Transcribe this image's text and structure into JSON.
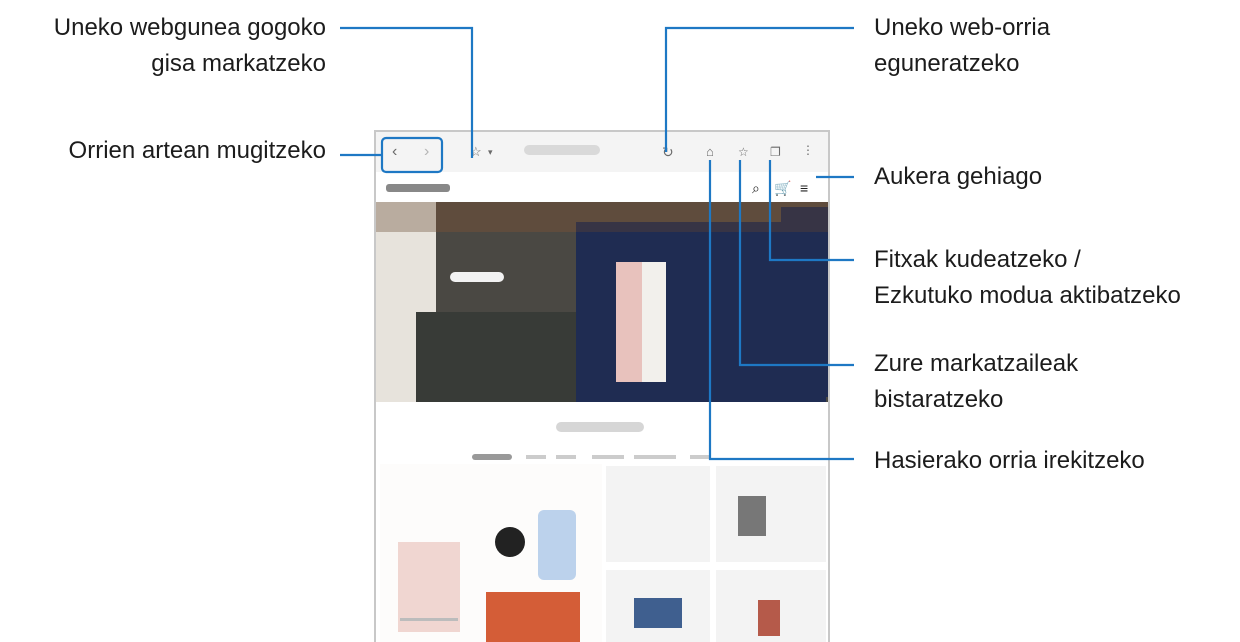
{
  "callouts": {
    "bookmark_current": {
      "line1": "Uneko webgunea gogoko",
      "line2": "gisa markatzeko"
    },
    "refresh": {
      "line1": "Uneko web-orria",
      "line2": "eguneratzeko"
    },
    "navigate": "Orrien artean mugitzeko",
    "more_options": "Aukera gehiago",
    "tabs": {
      "line1": "Fitxak kudeatzeko /",
      "line2": "Ezkutuko modua aktibatzeko"
    },
    "bookmarks": {
      "line1": "Zure markatzaileak",
      "line2": "bistaratzeko"
    },
    "home": "Hasierako orria irekitzeko"
  },
  "colors": {
    "accent": "#1e78c4"
  }
}
